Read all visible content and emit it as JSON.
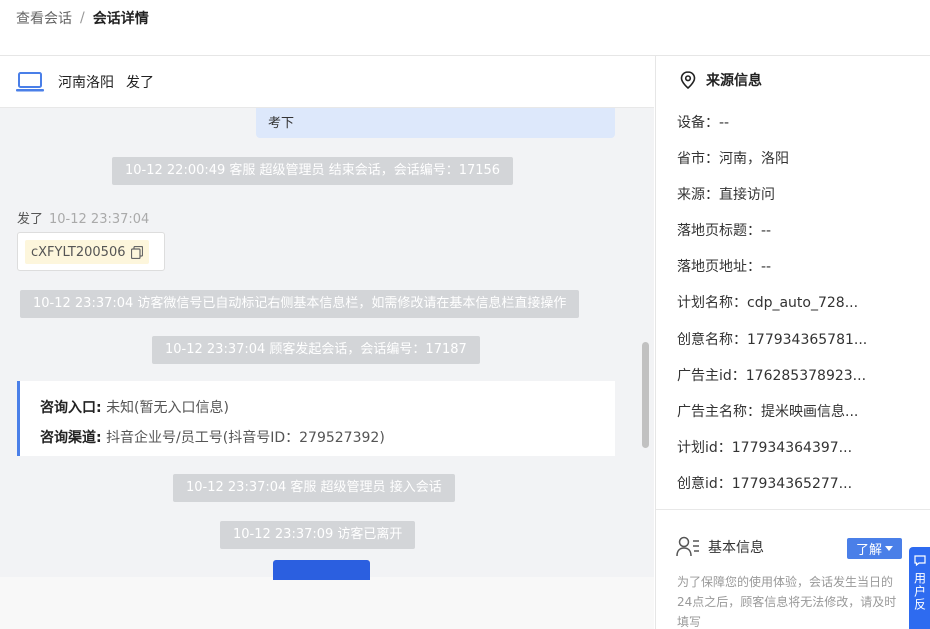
{
  "breadcrumb": {
    "parent": "查看会话",
    "separator": "/",
    "current": "会话详情"
  },
  "chat": {
    "header": {
      "location": "河南洛阳",
      "visitor_name": "发了"
    },
    "messages": {
      "agent_bubble": "考下",
      "sys1": "10-12 22:00:49 客服 超级管理员 结束会话，会话编号：17156",
      "visitor_name": "发了",
      "visitor_time": "10-12 23:37:04",
      "code": "cXFYLT200506",
      "sys2": "10-12 23:37:04 访客微信号已自动标记右侧基本信息栏，如需修改请在基本信息栏直接操作",
      "sys3": "10-12 23:37:04 顾客发起会话，会话编号：17187",
      "entry_label": "咨询入口:",
      "entry_value": "未知(暂无入口信息)",
      "channel_label": "咨询渠道:",
      "channel_value": "抖音企业号/员工号(抖音号ID：279527392)",
      "sys4": "10-12 23:37:04 客服 超级管理员 接入会话",
      "sys5": "10-12 23:37:09 访客已离开"
    }
  },
  "source_info": {
    "title": "来源信息",
    "rows": [
      "设备：--",
      "省市：河南，洛阳",
      "来源：直接访问",
      "落地页标题：--",
      "落地页地址：--",
      "计划名称：cdp_auto_728...",
      "创意名称：177934365781...",
      "广告主id：176285378923...",
      "广告主名称：提米映画信息...",
      "计划id：177934364397...",
      "创意id：177934365277..."
    ]
  },
  "basic_info": {
    "title": "基本信息",
    "learn_button": "了解",
    "note": "为了保障您的使用体验，会话发生当日的24点之后，顾客信息将无法修改，请及时填写"
  },
  "float_widget": {
    "text": "用户反"
  },
  "colors": {
    "accent": "#4a7fe8",
    "system_msg": "#d3d5d8",
    "agent_bubble": "#dde8fb"
  }
}
